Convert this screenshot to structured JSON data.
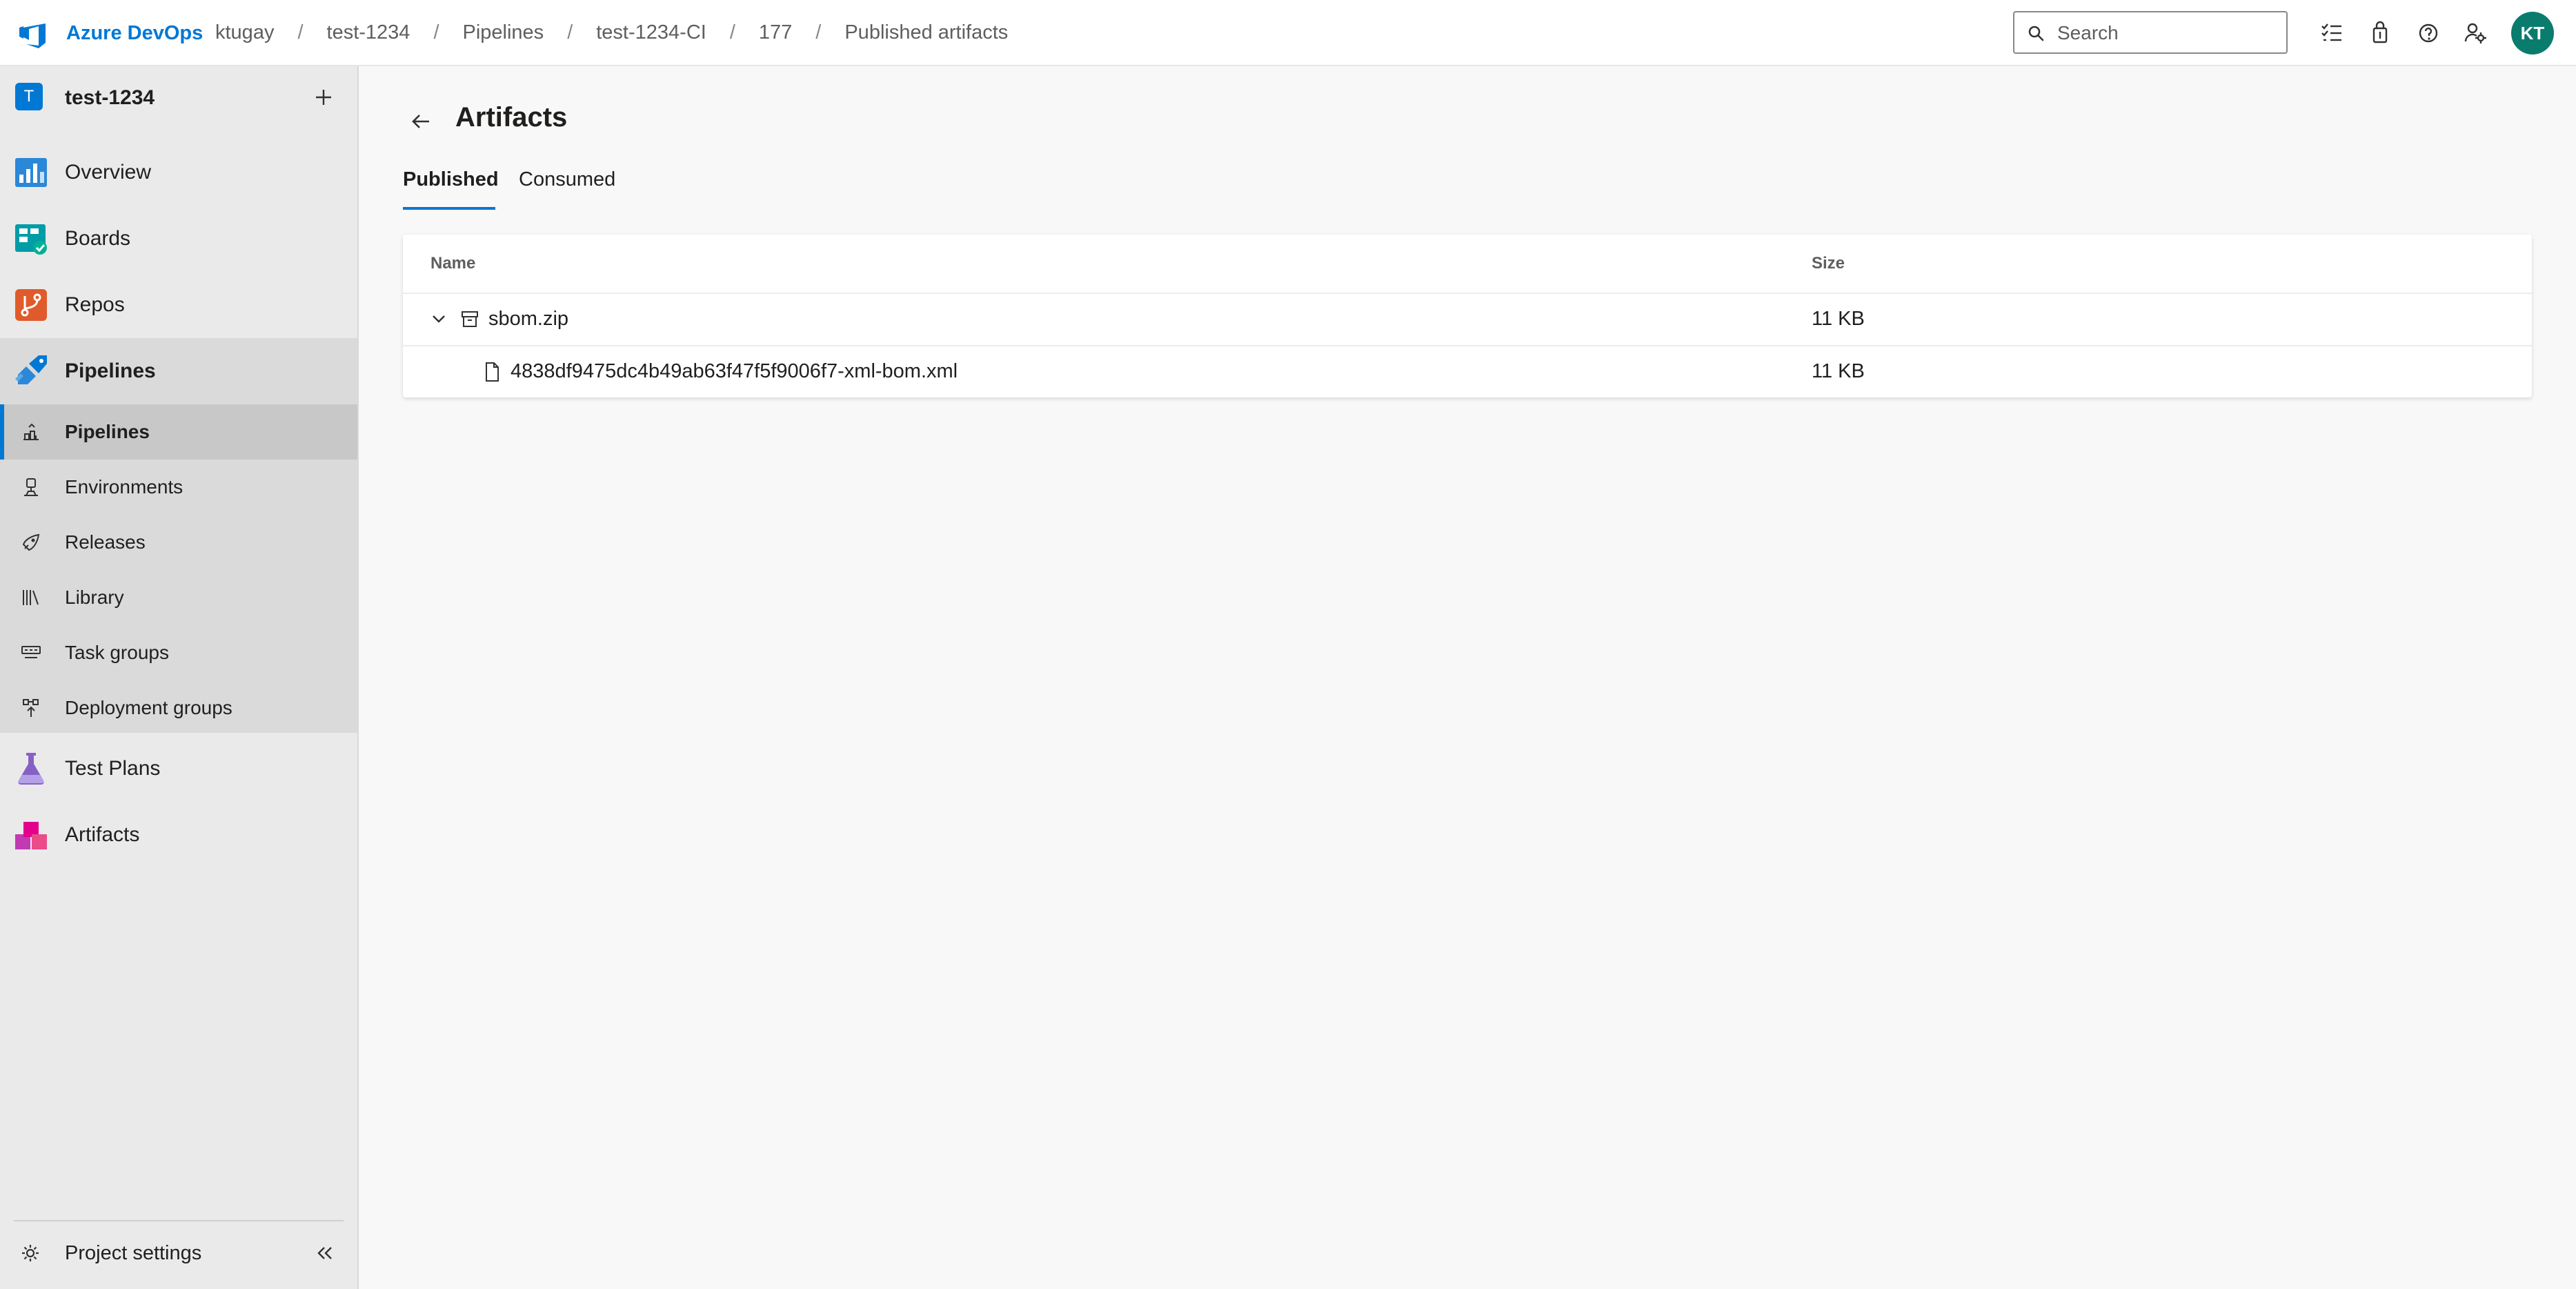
{
  "header": {
    "brand": "Azure DevOps",
    "breadcrumbs": [
      "ktugay",
      "test-1234",
      "Pipelines",
      "test-1234-CI",
      "177",
      "Published artifacts"
    ],
    "search_placeholder": "Search",
    "user_initials": "KT",
    "accent_color": "#0078d4"
  },
  "sidebar": {
    "project_initial": "T",
    "project_name": "test-1234",
    "items": [
      {
        "label": "Overview",
        "icon": "overview-icon"
      },
      {
        "label": "Boards",
        "icon": "boards-icon"
      },
      {
        "label": "Repos",
        "icon": "repos-icon"
      },
      {
        "label": "Pipelines",
        "icon": "pipelines-icon"
      },
      {
        "label": "Test Plans",
        "icon": "test-plans-icon"
      },
      {
        "label": "Artifacts",
        "icon": "artifacts-icon"
      }
    ],
    "pipelines_sub": [
      {
        "label": "Pipelines",
        "icon": "pipelines-sub-icon",
        "selected": true
      },
      {
        "label": "Environments",
        "icon": "environments-icon"
      },
      {
        "label": "Releases",
        "icon": "releases-icon"
      },
      {
        "label": "Library",
        "icon": "library-icon"
      },
      {
        "label": "Task groups",
        "icon": "task-groups-icon"
      },
      {
        "label": "Deployment groups",
        "icon": "deployment-groups-icon"
      }
    ],
    "settings_label": "Project settings"
  },
  "main": {
    "title": "Artifacts",
    "tabs": [
      {
        "label": "Published",
        "active": true
      },
      {
        "label": "Consumed",
        "active": false
      }
    ],
    "table": {
      "columns": [
        "Name",
        "Size"
      ],
      "rows": [
        {
          "name": "sbom.zip",
          "size": "11 KB",
          "type": "archive",
          "expanded": true
        },
        {
          "name": "4838df9475dc4b49ab63f47f5f9006f7-xml-bom.xml",
          "size": "11 KB",
          "type": "file"
        }
      ]
    }
  }
}
